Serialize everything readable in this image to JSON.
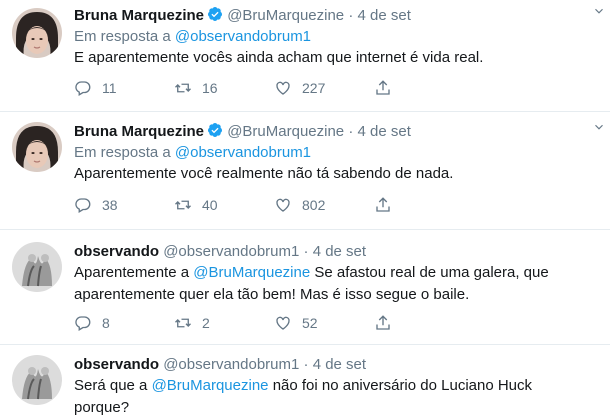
{
  "tweets": [
    {
      "name": "Bruna Marquezine",
      "verified": true,
      "handle": "@BruMarquezine",
      "separator": "·",
      "date": "4 de set",
      "reply_prefix": "Em resposta a",
      "reply_to": "@observandobrum1",
      "text_parts": [
        "E aparentemente vocês ainda acham que internet é vida real."
      ],
      "replies": "11",
      "retweets": "16",
      "likes": "227"
    },
    {
      "name": "Bruna Marquezine",
      "verified": true,
      "handle": "@BruMarquezine",
      "separator": "·",
      "date": "4 de set",
      "reply_prefix": "Em resposta a",
      "reply_to": "@observandobrum1",
      "text_parts": [
        "Aparentemente você realmente não tá sabendo de nada."
      ],
      "replies": "38",
      "retweets": "40",
      "likes": "802"
    },
    {
      "name": "observando",
      "verified": false,
      "handle": "@observandobrum1",
      "separator": "·",
      "date": "4 de set",
      "text_line1_pre": "Aparentemente a",
      "text_line1_mention": "@BruMarquezine",
      "text_line1_post": "Se afastou real de uma galera, que",
      "text_line2": "aparentemente quer ela tão bem! Mas é isso segue o baile.",
      "replies": "8",
      "retweets": "2",
      "likes": "52"
    },
    {
      "name": "observando",
      "verified": false,
      "handle": "@observandobrum1",
      "separator": "·",
      "date": "4 de set",
      "text_line1_pre": "Será que a",
      "text_line1_mention": "@BruMarquezine",
      "text_line1_post": "não foi no aniversário do Luciano Huck",
      "text_line2": "porque?"
    }
  ],
  "colors": {
    "link": "#1b95e0",
    "secondary_text": "#657786",
    "border": "#e6ecf0",
    "verified": "#1da1f2"
  },
  "icons": [
    "reply-icon",
    "retweet-icon",
    "like-icon",
    "share-icon",
    "verified-badge-icon",
    "caret-down-icon"
  ]
}
